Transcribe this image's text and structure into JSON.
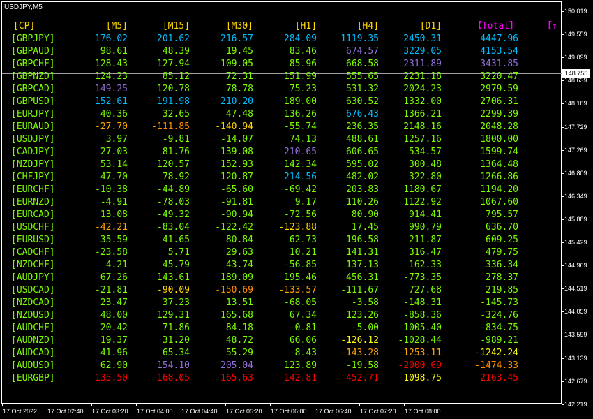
{
  "window": {
    "symbol": "USDJPY,M5"
  },
  "colors": {
    "pair_color": "#7cfc00",
    "header_color": "#ffd700",
    "total_header_color": "#ff00ff"
  },
  "headers": [
    "[CP]",
    "[M5]",
    "[M15]",
    "[M30]",
    "[H1]",
    "[H4]",
    "[D1]",
    "【Total】",
    "【↑"
  ],
  "header_colors": [
    "#ffd700",
    "#ffd700",
    "#ffd700",
    "#ffd700",
    "#ffd700",
    "#ffd700",
    "#ffd700",
    "#ff00ff",
    "#ff00ff"
  ],
  "rows": [
    {
      "pair": "[GBPJPY]",
      "values": [
        "176.02",
        "201.62",
        "216.57",
        "284.09",
        "1119.35",
        "2450.31",
        "4447.96"
      ],
      "colors": [
        "#00bfff",
        "#00bfff",
        "#00bfff",
        "#00bfff",
        "#00bfff",
        "#00bfff",
        "#00bfff"
      ]
    },
    {
      "pair": "[GBPAUD]",
      "values": [
        "98.61",
        "48.39",
        "19.45",
        "83.46",
        "674.57",
        "3229.05",
        "4153.54"
      ],
      "colors": [
        "#7cfc00",
        "#7cfc00",
        "#7cfc00",
        "#7cfc00",
        "#9370db",
        "#00bfff",
        "#00bfff"
      ]
    },
    {
      "pair": "[GBPCHF]",
      "values": [
        "128.43",
        "127.94",
        "109.05",
        "85.96",
        "668.58",
        "2311.89",
        "3431.85"
      ],
      "colors": [
        "#7cfc00",
        "#7cfc00",
        "#7cfc00",
        "#7cfc00",
        "#7cfc00",
        "#9370db",
        "#9370db"
      ]
    },
    {
      "pair": "[GBPNZD]",
      "values": [
        "124.23",
        "85.12",
        "72.31",
        "151.99",
        "555.65",
        "2231.18",
        "3220.47"
      ],
      "colors": [
        "#7cfc00",
        "#7cfc00",
        "#7cfc00",
        "#7cfc00",
        "#7cfc00",
        "#7cfc00",
        "#7cfc00"
      ]
    },
    {
      "pair": "[GBPCAD]",
      "values": [
        "149.25",
        "120.78",
        "78.78",
        "75.23",
        "531.32",
        "2024.23",
        "2979.59"
      ],
      "colors": [
        "#9370db",
        "#7cfc00",
        "#7cfc00",
        "#7cfc00",
        "#7cfc00",
        "#7cfc00",
        "#7cfc00"
      ]
    },
    {
      "pair": "[GBPUSD]",
      "values": [
        "152.61",
        "191.98",
        "210.20",
        "189.00",
        "630.52",
        "1332.00",
        "2706.31"
      ],
      "colors": [
        "#00bfff",
        "#00bfff",
        "#00bfff",
        "#7cfc00",
        "#7cfc00",
        "#7cfc00",
        "#7cfc00"
      ]
    },
    {
      "pair": "[EURJPY]",
      "values": [
        "40.36",
        "32.65",
        "47.48",
        "136.26",
        "676.43",
        "1366.21",
        "2299.39"
      ],
      "colors": [
        "#7cfc00",
        "#7cfc00",
        "#7cfc00",
        "#7cfc00",
        "#00bfff",
        "#7cfc00",
        "#7cfc00"
      ]
    },
    {
      "pair": "[EURAUD]",
      "values": [
        "-27.70",
        "-111.85",
        "-140.94",
        "-55.74",
        "236.35",
        "2148.16",
        "2048.28"
      ],
      "colors": [
        "#ffa500",
        "#ff8c00",
        "#ffd700",
        "#7cfc00",
        "#7cfc00",
        "#7cfc00",
        "#7cfc00"
      ]
    },
    {
      "pair": "[USDJPY]",
      "values": [
        "3.97",
        "-9.81",
        "-14.07",
        "74.13",
        "488.61",
        "1257.16",
        "1800.00"
      ],
      "colors": [
        "#7cfc00",
        "#7cfc00",
        "#7cfc00",
        "#7cfc00",
        "#7cfc00",
        "#7cfc00",
        "#7cfc00"
      ]
    },
    {
      "pair": "[CADJPY]",
      "values": [
        "27.03",
        "81.76",
        "139.08",
        "210.65",
        "606.65",
        "534.57",
        "1599.74"
      ],
      "colors": [
        "#7cfc00",
        "#7cfc00",
        "#7cfc00",
        "#9370db",
        "#7cfc00",
        "#7cfc00",
        "#7cfc00"
      ]
    },
    {
      "pair": "[NZDJPY]",
      "values": [
        "53.14",
        "120.57",
        "152.93",
        "142.34",
        "595.02",
        "300.48",
        "1364.48"
      ],
      "colors": [
        "#7cfc00",
        "#7cfc00",
        "#7cfc00",
        "#7cfc00",
        "#7cfc00",
        "#7cfc00",
        "#7cfc00"
      ]
    },
    {
      "pair": "[CHFJPY]",
      "values": [
        "47.70",
        "78.92",
        "120.87",
        "214.56",
        "482.02",
        "322.80",
        "1266.86"
      ],
      "colors": [
        "#7cfc00",
        "#7cfc00",
        "#7cfc00",
        "#00bfff",
        "#7cfc00",
        "#7cfc00",
        "#7cfc00"
      ]
    },
    {
      "pair": "[EURCHF]",
      "values": [
        "-10.38",
        "-44.89",
        "-65.60",
        "-69.42",
        "203.83",
        "1180.67",
        "1194.20"
      ],
      "colors": [
        "#7cfc00",
        "#7cfc00",
        "#7cfc00",
        "#7cfc00",
        "#7cfc00",
        "#7cfc00",
        "#7cfc00"
      ]
    },
    {
      "pair": "[EURNZD]",
      "values": [
        "-4.91",
        "-78.03",
        "-91.81",
        "9.17",
        "110.26",
        "1122.92",
        "1067.60"
      ],
      "colors": [
        "#7cfc00",
        "#7cfc00",
        "#7cfc00",
        "#7cfc00",
        "#7cfc00",
        "#7cfc00",
        "#7cfc00"
      ]
    },
    {
      "pair": "[EURCAD]",
      "values": [
        "13.08",
        "-49.32",
        "-90.94",
        "-72.56",
        "80.90",
        "914.41",
        "795.57"
      ],
      "colors": [
        "#7cfc00",
        "#7cfc00",
        "#7cfc00",
        "#7cfc00",
        "#7cfc00",
        "#7cfc00",
        "#7cfc00"
      ]
    },
    {
      "pair": "[USDCHF]",
      "values": [
        "-42.21",
        "-83.04",
        "-122.42",
        "-123.88",
        "17.45",
        "990.79",
        "636.70"
      ],
      "colors": [
        "#ffa500",
        "#7cfc00",
        "#7cfc00",
        "#ffd700",
        "#7cfc00",
        "#7cfc00",
        "#7cfc00"
      ]
    },
    {
      "pair": "[EURUSD]",
      "values": [
        "35.59",
        "41.65",
        "80.84",
        "62.73",
        "196.58",
        "211.87",
        "609.25"
      ],
      "colors": [
        "#7cfc00",
        "#7cfc00",
        "#7cfc00",
        "#7cfc00",
        "#7cfc00",
        "#7cfc00",
        "#7cfc00"
      ]
    },
    {
      "pair": "[CADCHF]",
      "values": [
        "-23.58",
        "5.71",
        "29.63",
        "10.21",
        "141.31",
        "316.47",
        "479.75"
      ],
      "colors": [
        "#7cfc00",
        "#7cfc00",
        "#7cfc00",
        "#7cfc00",
        "#7cfc00",
        "#7cfc00",
        "#7cfc00"
      ]
    },
    {
      "pair": "[NZDCHF]",
      "values": [
        "4.21",
        "45.79",
        "43.74",
        "-56.85",
        "137.13",
        "162.33",
        "336.34"
      ],
      "colors": [
        "#7cfc00",
        "#7cfc00",
        "#7cfc00",
        "#7cfc00",
        "#7cfc00",
        "#7cfc00",
        "#7cfc00"
      ]
    },
    {
      "pair": "[AUDJPY]",
      "values": [
        "67.26",
        "143.61",
        "189.09",
        "195.46",
        "456.31",
        "-773.35",
        "278.37"
      ],
      "colors": [
        "#7cfc00",
        "#7cfc00",
        "#7cfc00",
        "#7cfc00",
        "#7cfc00",
        "#7cfc00",
        "#7cfc00"
      ]
    },
    {
      "pair": "[USDCAD]",
      "values": [
        "-21.81",
        "-90.09",
        "-150.69",
        "-133.57",
        "-111.67",
        "727.68",
        "219.85"
      ],
      "colors": [
        "#7cfc00",
        "#ffd700",
        "#ff8c00",
        "#ffa500",
        "#7cfc00",
        "#7cfc00",
        "#7cfc00"
      ]
    },
    {
      "pair": "[NZDCAD]",
      "values": [
        "23.47",
        "37.23",
        "13.51",
        "-68.05",
        "-3.58",
        "-148.31",
        "-145.73"
      ],
      "colors": [
        "#7cfc00",
        "#7cfc00",
        "#7cfc00",
        "#7cfc00",
        "#7cfc00",
        "#7cfc00",
        "#7cfc00"
      ]
    },
    {
      "pair": "[NZDUSD]",
      "values": [
        "48.00",
        "129.31",
        "165.68",
        "67.34",
        "123.26",
        "-858.36",
        "-324.76"
      ],
      "colors": [
        "#7cfc00",
        "#7cfc00",
        "#7cfc00",
        "#7cfc00",
        "#7cfc00",
        "#7cfc00",
        "#7cfc00"
      ]
    },
    {
      "pair": "[AUDCHF]",
      "values": [
        "20.42",
        "71.86",
        "84.18",
        "-0.81",
        "-5.00",
        "-1005.40",
        "-834.75"
      ],
      "colors": [
        "#7cfc00",
        "#7cfc00",
        "#7cfc00",
        "#7cfc00",
        "#7cfc00",
        "#7cfc00",
        "#7cfc00"
      ]
    },
    {
      "pair": "[AUDNZD]",
      "values": [
        "19.37",
        "31.20",
        "48.72",
        "66.06",
        "-126.12",
        "-1028.44",
        "-989.21"
      ],
      "colors": [
        "#7cfc00",
        "#7cfc00",
        "#7cfc00",
        "#7cfc00",
        "#ffff00",
        "#7cfc00",
        "#7cfc00"
      ]
    },
    {
      "pair": "[AUDCAD]",
      "values": [
        "41.96",
        "65.34",
        "55.29",
        "-8.43",
        "-143.28",
        "-1253.11",
        "-1242.24"
      ],
      "colors": [
        "#7cfc00",
        "#7cfc00",
        "#7cfc00",
        "#7cfc00",
        "#ffa500",
        "#ffa500",
        "#ffff00"
      ]
    },
    {
      "pair": "[AUDUSD]",
      "values": [
        "62.90",
        "154.10",
        "205.04",
        "123.89",
        "-19.58",
        "-2000.69",
        "-1474.33"
      ],
      "colors": [
        "#7cfc00",
        "#9370db",
        "#9370db",
        "#7cfc00",
        "#7cfc00",
        "#ff0000",
        "#ff8c00"
      ]
    },
    {
      "pair": "[EURGBP]",
      "values": [
        "-135.50",
        "-168.05",
        "-165.63",
        "-142.81",
        "-452.71",
        "-1098.75",
        "-2163.45"
      ],
      "colors": [
        "#ff0000",
        "#ff0000",
        "#ff0000",
        "#ff0000",
        "#ff0000",
        "#ffff00",
        "#ff0000"
      ]
    }
  ],
  "price_axis": {
    "ticks": [
      "150.019",
      "149.559",
      "149.099",
      "148.639",
      "148.189",
      "147.729",
      "147.269",
      "146.809",
      "146.349",
      "145.889",
      "145.429",
      "144.969",
      "144.519",
      "144.059",
      "143.599",
      "143.139",
      "142.679",
      "142.219"
    ],
    "current_price": "148.755"
  },
  "time_axis": {
    "ticks": [
      "17 Oct 2022",
      "17 Oct 02:40",
      "17 Oct 03:20",
      "17 Oct 04:00",
      "17 Oct 04:40",
      "17 Oct 05:20",
      "17 Oct 06:00",
      "17 Oct 06:40",
      "17 Oct 07:20",
      "17 Oct 08:00"
    ]
  }
}
